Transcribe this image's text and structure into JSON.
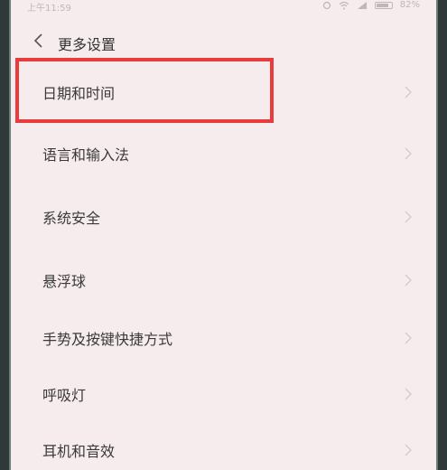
{
  "status": {
    "time": "上午11:59",
    "battery": "82%",
    "battery_level": 0.82
  },
  "header": {
    "title": "更多设置"
  },
  "items": [
    {
      "label": "日期和时间"
    },
    {
      "label": "语言和输入法"
    },
    {
      "label": "系统安全"
    },
    {
      "label": "悬浮球"
    },
    {
      "label": "手势及按键快捷方式"
    },
    {
      "label": "呼吸灯"
    },
    {
      "label": "耳机和音效"
    }
  ],
  "colors": {
    "highlight": "#e83b3b",
    "background": "#f6ecee"
  }
}
